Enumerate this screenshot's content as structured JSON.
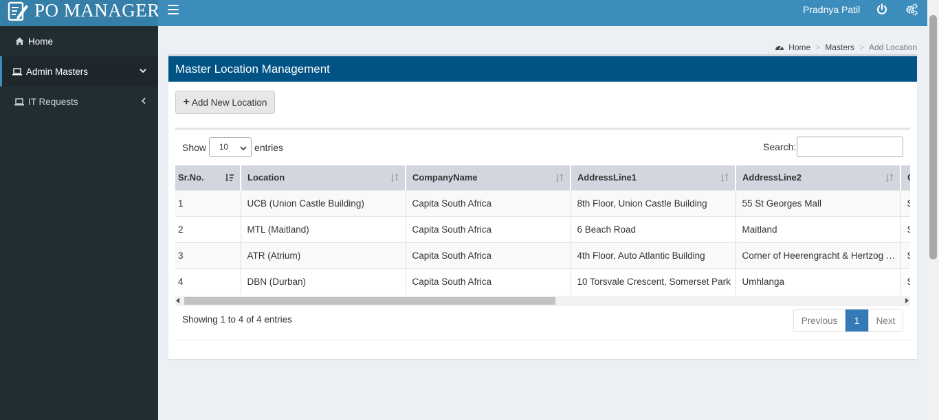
{
  "app": {
    "title": "PO MANAGER"
  },
  "sidebar": {
    "items": [
      {
        "label": "Home",
        "icon": "home-icon"
      },
      {
        "label": "Admin Masters",
        "icon": "laptop-icon",
        "active": true
      },
      {
        "label": "IT Requests",
        "icon": "laptop-icon"
      }
    ]
  },
  "header": {
    "user": "Pradnya Patil"
  },
  "breadcrumb": {
    "home": "Home",
    "masters": "Masters",
    "current": "Add Location"
  },
  "panel": {
    "title": "Master Location Management",
    "add_button": "Add New Location"
  },
  "table_controls": {
    "show_label": "Show",
    "entries_value": "10",
    "entries_label": "entries",
    "search_label": "Search:",
    "search_value": ""
  },
  "table": {
    "columns": [
      "Sr.No.",
      "Location",
      "CompanyName",
      "AddressLine1",
      "AddressLine2",
      "C"
    ],
    "rows": [
      [
        "1",
        "UCB (Union Castle Building)",
        "Capita South Africa",
        "8th Floor, Union Castle Building",
        "55 St Georges Mall",
        "S"
      ],
      [
        "2",
        "MTL (Maitland)",
        "Capita South Africa",
        "6 Beach Road",
        "Maitland",
        "S"
      ],
      [
        "3",
        "ATR (Atrium)",
        "Capita South Africa",
        "4th Floor, Auto Atlantic Building",
        "Corner of Heerengracht & Hertzog Boulevard",
        "S"
      ],
      [
        "4",
        "DBN (Durban)",
        "Capita South Africa",
        "10 Torsvale Crescent, Somerset Park",
        "Umhlanga",
        "S"
      ]
    ]
  },
  "footer": {
    "info": "Showing 1 to 4 of 4 entries",
    "previous": "Previous",
    "page": "1",
    "next": "Next"
  },
  "colors": {
    "header": "#3c8dbc",
    "logo_bg": "#367fa9",
    "sidebar": "#222d32",
    "panel_header": "#005384",
    "active_page": "#337ab7"
  }
}
